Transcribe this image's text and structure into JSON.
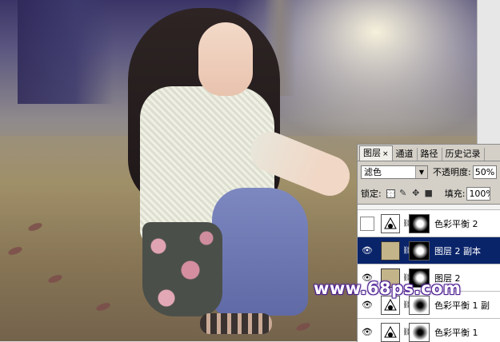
{
  "panel": {
    "tabs": [
      {
        "label": "图层",
        "active": true
      },
      {
        "label": "通道",
        "active": false
      },
      {
        "label": "路径",
        "active": false
      },
      {
        "label": "历史记录",
        "active": false
      }
    ],
    "close_glyph": "×",
    "blend_mode": "滤色",
    "opacity_label": "不透明度:",
    "opacity_value": "50%",
    "lock_label": "锁定:",
    "fill_label": "填充:",
    "fill_value": "100%",
    "layers": [
      {
        "name": "色彩平衡 2",
        "visible": false,
        "selected": false,
        "thumb": "adjustment-icon",
        "mask": "mask-black-dot"
      },
      {
        "name": "图层 2 副本",
        "visible": true,
        "selected": true,
        "thumb": "fill-tan",
        "mask": "mask-black-dot"
      },
      {
        "name": "图层 2",
        "visible": true,
        "selected": false,
        "thumb": "fill-tan",
        "mask": "mask-black-dot"
      },
      {
        "name": "色彩平衡 1 副",
        "visible": true,
        "selected": false,
        "thumb": "adjustment-icon",
        "mask": "mask-white-blob"
      },
      {
        "name": "色彩平衡 1",
        "visible": true,
        "selected": false,
        "thumb": "adjustment-icon",
        "mask": "mask-white-blob"
      }
    ]
  },
  "watermark": "www.68ps.com",
  "colors": {
    "selected_row": "#0a246a",
    "layer_fill": "#c4b48a",
    "panel_bg": "#d4d0c8"
  }
}
